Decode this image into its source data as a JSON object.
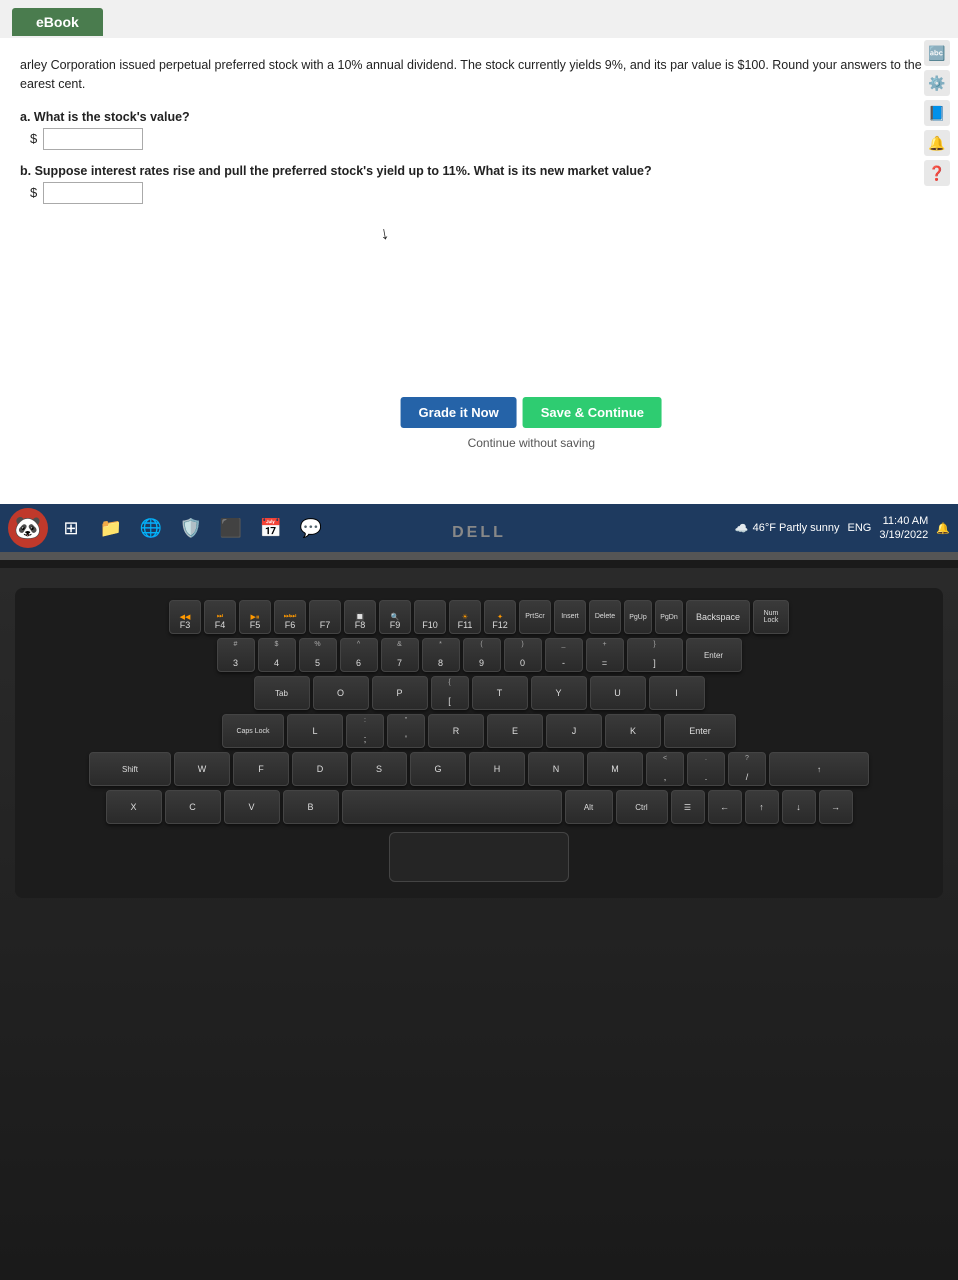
{
  "screen": {
    "ebook_tab": "eBook",
    "question_intro": "arley Corporation issued perpetual preferred stock with a 10% annual dividend. The stock currently yields 9%, and its par value is $100. Round your answers to the earest cent.",
    "sub_a_label": "a. What is the stock's value?",
    "sub_a_dollar": "$",
    "sub_b_label": "b. Suppose interest rates rise and pull the preferred stock's yield up to 11%. What is its new market value?",
    "sub_b_dollar": "$",
    "btn_grade": "Grade it Now",
    "btn_save": "Save & Continue",
    "continue_link": "Continue without saving"
  },
  "taskbar": {
    "weather": "46°F Partly sunny",
    "time": "11:40 AM",
    "date": "3/19/2022",
    "language": "ENG"
  },
  "dell_logo": "DELL",
  "keyboard": {
    "function_row": [
      "F3",
      "F4",
      "F5",
      "F6",
      "F7",
      "F8",
      "F9",
      "F10",
      "F11",
      "F12",
      "PrtScr",
      "Insert",
      "Delete",
      "Backspace"
    ],
    "number_row": [
      "#\n3",
      "$\n4",
      "%\n5",
      "^\n6",
      "&\n7",
      "*\n8",
      "(\n9",
      ")\n0",
      "-",
      "="
    ],
    "qwerty_row": [
      "Tab",
      "Y",
      "U",
      "I",
      "O",
      "P"
    ],
    "asdf_row": [
      "Caps",
      "T",
      "J",
      "K",
      "L"
    ],
    "zxcv_row": [
      "Shift",
      "G",
      "H",
      "M",
      "N",
      "B",
      "V",
      "C",
      "X"
    ],
    "bottom_row": [
      "Ctrl",
      "Alt",
      "Space",
      "Alt",
      "Ctrl"
    ]
  }
}
